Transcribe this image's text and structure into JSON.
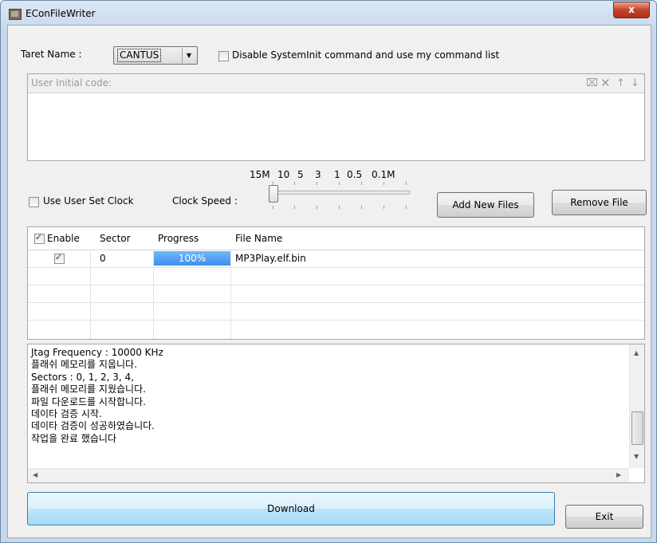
{
  "window": {
    "title": "EConFileWriter",
    "close_label": "x"
  },
  "target": {
    "label": "Taret Name :",
    "selected": "CANTUS",
    "disable_init_label": "Disable SystemInit command and use my command list",
    "disable_init_checked": false
  },
  "user_code": {
    "label": "User Initial code:",
    "value": ""
  },
  "clock": {
    "speed_labels": [
      "15M",
      "10",
      "5",
      "3",
      "1",
      "0.5",
      "0.1M"
    ],
    "use_user_clock_label": "Use User Set Clock",
    "use_user_clock_checked": false,
    "speed_label": "Clock Speed :",
    "slider_index": 0
  },
  "buttons": {
    "add_files": "Add New Files",
    "remove_file": "Remove File",
    "download": "Download",
    "exit": "Exit"
  },
  "files": {
    "columns": [
      "Enable",
      "Sector",
      "Progress",
      "File Name"
    ],
    "header_checked": true,
    "rows": [
      {
        "enabled": true,
        "sector": "0",
        "progress_label": "100%",
        "progress": 1.0,
        "file_name": "MP3Play.elf.bin"
      }
    ]
  },
  "log": {
    "lines": [
      "Jtag Frequency : 10000 KHz",
      "플래쉬 메모리를 지웁니다.",
      "Sectors : 0, 1, 2, 3, 4,",
      "플래쉬 메모리를 지웠습니다.",
      "파일 다운로드를 시작합니다.",
      "데이타 검증 시작.",
      "데이타 검증이 성공하였습니다.",
      "작업을 완료 했습니다"
    ]
  },
  "colors": {
    "progress_fill": "#3e8fe8",
    "download_accent": "#bee6fd"
  }
}
